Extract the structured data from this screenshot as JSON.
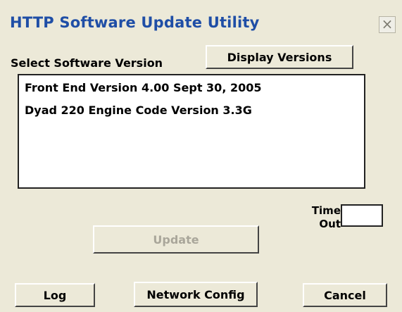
{
  "window": {
    "title": "HTTP Software Update Utility",
    "close_glyph": "×"
  },
  "version_select": {
    "label": "Select Software Version",
    "display_button": "Display Versions",
    "items": [
      "Front End Version 4.00 Sept 30, 2005",
      "Dyad 220 Engine Code Version 3.3G"
    ]
  },
  "timeout": {
    "label_line1": "Time",
    "label_line2": "Out",
    "value": ""
  },
  "buttons": {
    "update": "Update",
    "log": "Log",
    "network_config": "Network Config",
    "cancel": "Cancel"
  },
  "colors": {
    "title": "#1f4ea6",
    "background": "#ece9d8",
    "disabled_text": "#a9a69a"
  }
}
